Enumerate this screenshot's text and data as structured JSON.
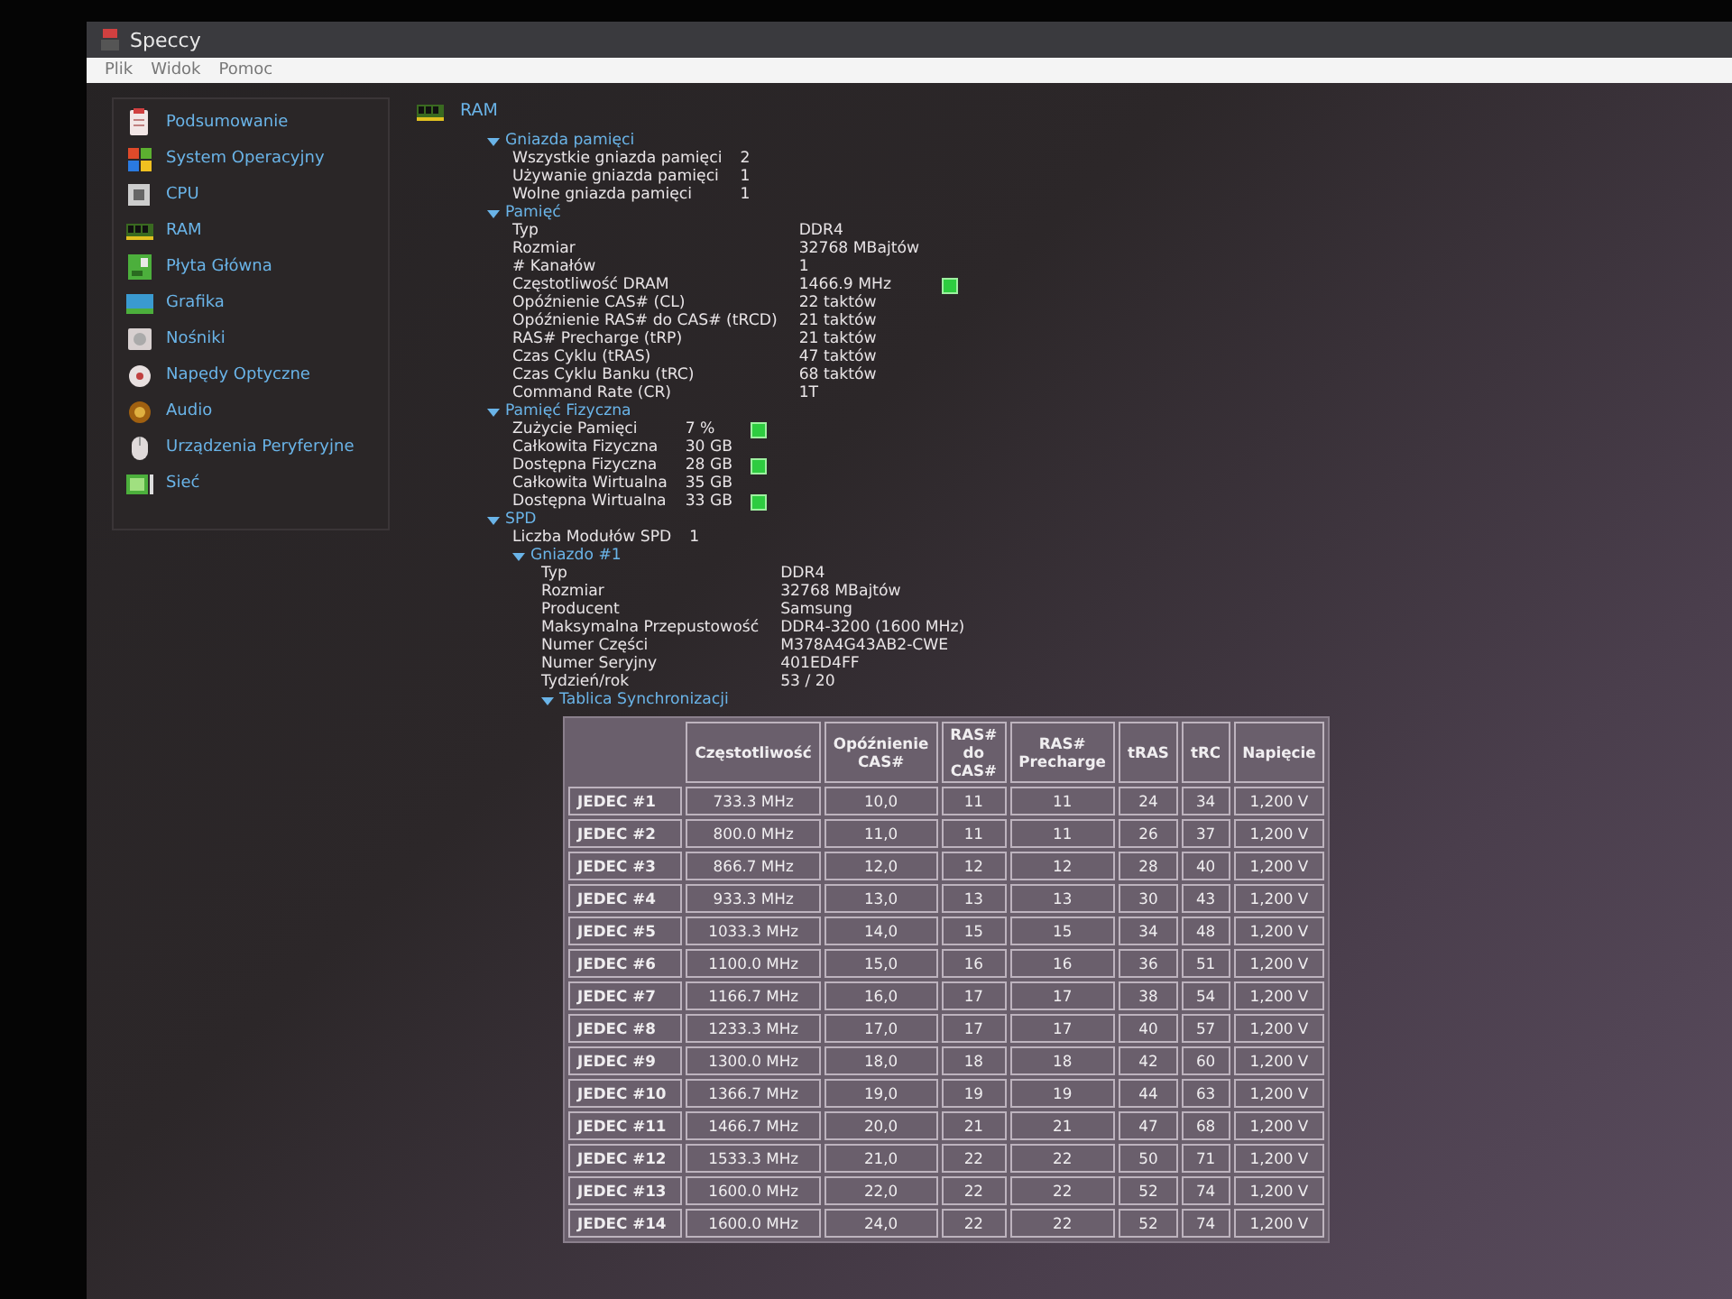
{
  "window": {
    "title": "Speccy"
  },
  "menu": [
    "Plik",
    "Widok",
    "Pomoc"
  ],
  "sidebar": {
    "items": [
      {
        "label": "Podsumowanie",
        "kind": "summary"
      },
      {
        "label": "System Operacyjny",
        "kind": "os"
      },
      {
        "label": "CPU",
        "kind": "cpu"
      },
      {
        "label": "RAM",
        "kind": "ram"
      },
      {
        "label": "Płyta Główna",
        "kind": "board"
      },
      {
        "label": "Grafika",
        "kind": "graphics"
      },
      {
        "label": "Nośniki",
        "kind": "storage"
      },
      {
        "label": "Napędy Optyczne",
        "kind": "optical"
      },
      {
        "label": "Audio",
        "kind": "audio"
      },
      {
        "label": "Urządzenia Peryferyjne",
        "kind": "peripherals"
      },
      {
        "label": "Sieć",
        "kind": "network"
      }
    ]
  },
  "content": {
    "title": "RAM",
    "sections": [
      {
        "title": "Gniazda pamięci",
        "expanded": true,
        "rows": [
          {
            "label": "Wszystkie gniazda pamięci",
            "value": "2"
          },
          {
            "label": "Używanie gniazda pamięci",
            "value": "1"
          },
          {
            "label": "Wolne gniazda pamięci",
            "value": "1"
          }
        ]
      },
      {
        "title": "Pamięć",
        "expanded": true,
        "rows": [
          {
            "label": "Typ",
            "value": "DDR4",
            "graph": false
          },
          {
            "label": "Rozmiar",
            "value": "32768 MBajtów",
            "graph": false
          },
          {
            "label": "# Kanałów",
            "value": "1",
            "graph": false
          },
          {
            "label": "Częstotliwość DRAM",
            "value": "1466.9 MHz",
            "graph": true
          },
          {
            "label": "Opóźnienie CAS# (CL)",
            "value": "22 taktów",
            "graph": false
          },
          {
            "label": "Opóźnienie RAS# do CAS# (tRCD)",
            "value": "21 taktów",
            "graph": false
          },
          {
            "label": "RAS# Precharge (tRP)",
            "value": "21 taktów",
            "graph": false
          },
          {
            "label": "Czas Cyklu (tRAS)",
            "value": "47 taktów",
            "graph": false
          },
          {
            "label": "Czas Cyklu Banku (tRC)",
            "value": "68 taktów",
            "graph": false
          },
          {
            "label": "Command Rate (CR)",
            "value": "1T",
            "graph": false
          }
        ]
      },
      {
        "title": "Pamięć Fizyczna",
        "expanded": true,
        "rows": [
          {
            "label": "Zużycie Pamięci",
            "value": "7 %",
            "graph": true
          },
          {
            "label": "Całkowita Fizyczna",
            "value": "30 GB",
            "graph": false
          },
          {
            "label": "Dostępna Fizyczna",
            "value": "28 GB",
            "graph": true
          },
          {
            "label": "Całkowita Wirtualna",
            "value": "35 GB",
            "graph": false
          },
          {
            "label": "Dostępna Wirtualna",
            "value": "33 GB",
            "graph": true
          }
        ]
      }
    ],
    "spd": {
      "title": "SPD",
      "expanded": true,
      "rows": [
        {
          "label": "Liczba Modułów SPD",
          "value": "1"
        }
      ],
      "slot": {
        "title": "Gniazdo #1",
        "expanded": true,
        "rows": [
          {
            "label": "Typ",
            "value": "DDR4"
          },
          {
            "label": "Rozmiar",
            "value": "32768 MBajtów"
          },
          {
            "label": "Producent",
            "value": "Samsung"
          },
          {
            "label": "Maksymalna Przepustowość",
            "value": "DDR4-3200 (1600 MHz)"
          },
          {
            "label": "Numer Części",
            "value": "M378A4G43AB2-CWE"
          },
          {
            "label": "Numer Seryjny",
            "value": "401ED4FF"
          },
          {
            "label": "Tydzień/rok",
            "value": "53 / 20"
          }
        ],
        "timing": {
          "title": "Tablica Synchronizacji",
          "expanded": true,
          "columns": [
            "",
            "Częstotliwość",
            "Opóźnienie CAS#",
            "RAS# do CAS#",
            "RAS# Precharge",
            "tRAS",
            "tRC",
            "Napięcie"
          ],
          "rows": [
            [
              "JEDEC #1",
              "733.3 MHz",
              "10,0",
              "11",
              "11",
              "24",
              "34",
              "1,200 V"
            ],
            [
              "JEDEC #2",
              "800.0 MHz",
              "11,0",
              "11",
              "11",
              "26",
              "37",
              "1,200 V"
            ],
            [
              "JEDEC #3",
              "866.7 MHz",
              "12,0",
              "12",
              "12",
              "28",
              "40",
              "1,200 V"
            ],
            [
              "JEDEC #4",
              "933.3 MHz",
              "13,0",
              "13",
              "13",
              "30",
              "43",
              "1,200 V"
            ],
            [
              "JEDEC #5",
              "1033.3 MHz",
              "14,0",
              "15",
              "15",
              "34",
              "48",
              "1,200 V"
            ],
            [
              "JEDEC #6",
              "1100.0 MHz",
              "15,0",
              "16",
              "16",
              "36",
              "51",
              "1,200 V"
            ],
            [
              "JEDEC #7",
              "1166.7 MHz",
              "16,0",
              "17",
              "17",
              "38",
              "54",
              "1,200 V"
            ],
            [
              "JEDEC #8",
              "1233.3 MHz",
              "17,0",
              "17",
              "17",
              "40",
              "57",
              "1,200 V"
            ],
            [
              "JEDEC #9",
              "1300.0 MHz",
              "18,0",
              "18",
              "18",
              "42",
              "60",
              "1,200 V"
            ],
            [
              "JEDEC #10",
              "1366.7 MHz",
              "19,0",
              "19",
              "19",
              "44",
              "63",
              "1,200 V"
            ],
            [
              "JEDEC #11",
              "1466.7 MHz",
              "20,0",
              "21",
              "21",
              "47",
              "68",
              "1,200 V"
            ],
            [
              "JEDEC #12",
              "1533.3 MHz",
              "21,0",
              "22",
              "22",
              "50",
              "71",
              "1,200 V"
            ],
            [
              "JEDEC #13",
              "1600.0 MHz",
              "22,0",
              "22",
              "22",
              "52",
              "74",
              "1,200 V"
            ],
            [
              "JEDEC #14",
              "1600.0 MHz",
              "24,0",
              "22",
              "22",
              "52",
              "74",
              "1,200 V"
            ]
          ]
        }
      }
    }
  }
}
